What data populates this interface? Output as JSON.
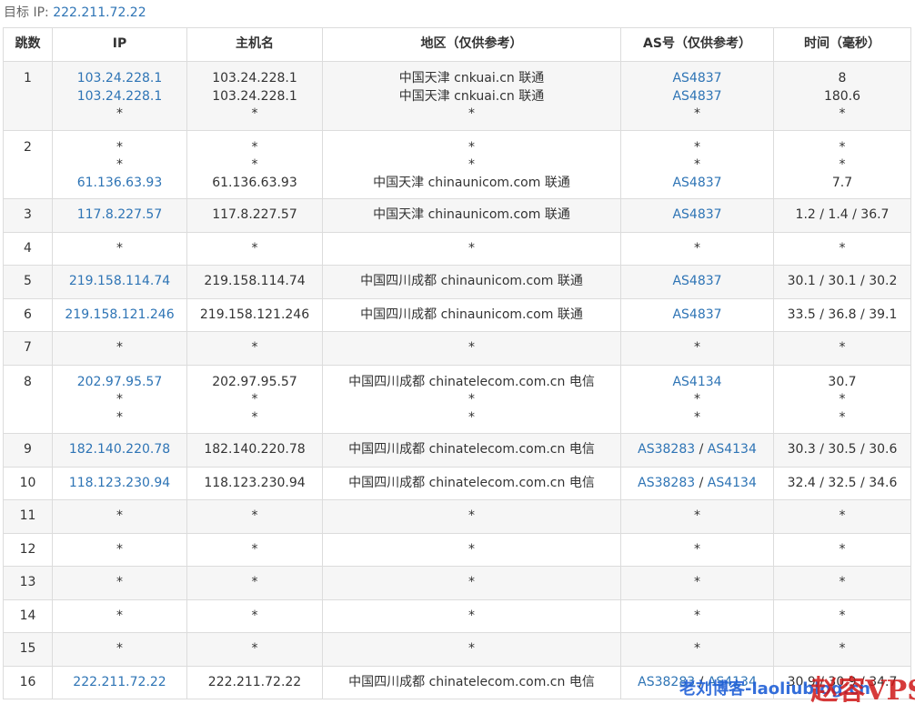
{
  "target": {
    "label": "目标 IP:",
    "ip": "222.211.72.22"
  },
  "columns": [
    "跳数",
    "IP",
    "主机名",
    "地区（仅供参考）",
    "AS号（仅供参考）",
    "时间（毫秒）"
  ],
  "hops": [
    {
      "hop": "1",
      "ip": [
        "103.24.228.1",
        "103.24.228.1",
        "*"
      ],
      "host": [
        "103.24.228.1",
        "103.24.228.1",
        "*"
      ],
      "region": [
        "中国天津 cnkuai.cn 联通",
        "中国天津 cnkuai.cn 联通",
        "*"
      ],
      "asn": [
        [
          "AS4837"
        ],
        [
          "AS4837"
        ],
        [
          "*"
        ]
      ],
      "time": [
        "8",
        "180.6",
        "*"
      ]
    },
    {
      "hop": "2",
      "ip": [
        "*",
        "*",
        "61.136.63.93"
      ],
      "host": [
        "*",
        "*",
        "61.136.63.93"
      ],
      "region": [
        "*",
        "*",
        "中国天津 chinaunicom.com 联通"
      ],
      "asn": [
        [
          "*"
        ],
        [
          "*"
        ],
        [
          "AS4837"
        ]
      ],
      "time": [
        "*",
        "*",
        "7.7"
      ]
    },
    {
      "hop": "3",
      "ip": [
        "117.8.227.57"
      ],
      "host": [
        "117.8.227.57"
      ],
      "region": [
        "中国天津 chinaunicom.com 联通"
      ],
      "asn": [
        [
          "AS4837"
        ]
      ],
      "time": [
        "1.2 / 1.4 / 36.7"
      ]
    },
    {
      "hop": "4",
      "ip": [
        "*"
      ],
      "host": [
        "*"
      ],
      "region": [
        "*"
      ],
      "asn": [
        [
          "*"
        ]
      ],
      "time": [
        "*"
      ]
    },
    {
      "hop": "5",
      "ip": [
        "219.158.114.74"
      ],
      "host": [
        "219.158.114.74"
      ],
      "region": [
        "中国四川成都 chinaunicom.com 联通"
      ],
      "asn": [
        [
          "AS4837"
        ]
      ],
      "time": [
        "30.1 / 30.1 / 30.2"
      ]
    },
    {
      "hop": "6",
      "ip": [
        "219.158.121.246"
      ],
      "host": [
        "219.158.121.246"
      ],
      "region": [
        "中国四川成都 chinaunicom.com 联通"
      ],
      "asn": [
        [
          "AS4837"
        ]
      ],
      "time": [
        "33.5 / 36.8 / 39.1"
      ]
    },
    {
      "hop": "7",
      "ip": [
        "*"
      ],
      "host": [
        "*"
      ],
      "region": [
        "*"
      ],
      "asn": [
        [
          "*"
        ]
      ],
      "time": [
        "*"
      ]
    },
    {
      "hop": "8",
      "ip": [
        "202.97.95.57",
        "*",
        "*"
      ],
      "host": [
        "202.97.95.57",
        "*",
        "*"
      ],
      "region": [
        "中国四川成都 chinatelecom.com.cn 电信",
        "*",
        "*"
      ],
      "asn": [
        [
          "AS4134"
        ],
        [
          "*"
        ],
        [
          "*"
        ]
      ],
      "time": [
        "30.7",
        "*",
        "*"
      ]
    },
    {
      "hop": "9",
      "ip": [
        "182.140.220.78"
      ],
      "host": [
        "182.140.220.78"
      ],
      "region": [
        "中国四川成都 chinatelecom.com.cn 电信"
      ],
      "asn": [
        [
          "AS38283",
          "AS4134"
        ]
      ],
      "time": [
        "30.3 / 30.5 / 30.6"
      ]
    },
    {
      "hop": "10",
      "ip": [
        "118.123.230.94"
      ],
      "host": [
        "118.123.230.94"
      ],
      "region": [
        "中国四川成都 chinatelecom.com.cn 电信"
      ],
      "asn": [
        [
          "AS38283",
          "AS4134"
        ]
      ],
      "time": [
        "32.4 / 32.5 / 34.6"
      ]
    },
    {
      "hop": "11",
      "ip": [
        "*"
      ],
      "host": [
        "*"
      ],
      "region": [
        "*"
      ],
      "asn": [
        [
          "*"
        ]
      ],
      "time": [
        "*"
      ]
    },
    {
      "hop": "12",
      "ip": [
        "*"
      ],
      "host": [
        "*"
      ],
      "region": [
        "*"
      ],
      "asn": [
        [
          "*"
        ]
      ],
      "time": [
        "*"
      ]
    },
    {
      "hop": "13",
      "ip": [
        "*"
      ],
      "host": [
        "*"
      ],
      "region": [
        "*"
      ],
      "asn": [
        [
          "*"
        ]
      ],
      "time": [
        "*"
      ]
    },
    {
      "hop": "14",
      "ip": [
        "*"
      ],
      "host": [
        "*"
      ],
      "region": [
        "*"
      ],
      "asn": [
        [
          "*"
        ]
      ],
      "time": [
        "*"
      ]
    },
    {
      "hop": "15",
      "ip": [
        "*"
      ],
      "host": [
        "*"
      ],
      "region": [
        "*"
      ],
      "asn": [
        [
          "*"
        ]
      ],
      "time": [
        "*"
      ]
    },
    {
      "hop": "16",
      "ip": [
        "222.211.72.22"
      ],
      "host": [
        "222.211.72.22"
      ],
      "region": [
        "中国四川成都 chinatelecom.com.cn 电信"
      ],
      "asn": [
        [
          "AS38283",
          "AS4134"
        ]
      ],
      "time": [
        "30.9 / 30.9 / 34.7"
      ]
    }
  ],
  "watermark": {
    "text1": "老刘博客-laoliublog.cn",
    "text2": "赵容VPS"
  },
  "colors": {
    "link": "#2e74b5",
    "border": "#dcdcdc",
    "alt_row": "#f6f6f6"
  }
}
